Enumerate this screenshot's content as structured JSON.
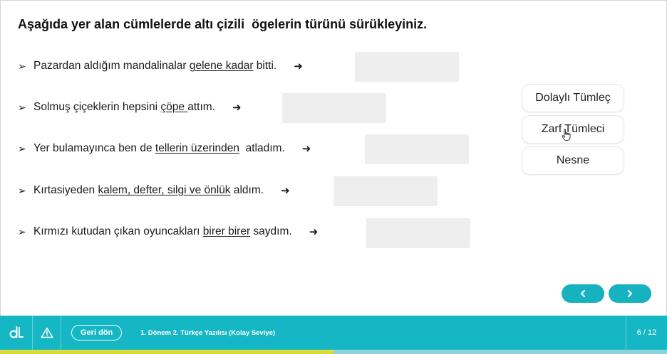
{
  "question": "Aşağıda yer alan cümlelerde altı çizili  ögelerin türünü sürükleyiniz.",
  "sentences": [
    {
      "before": "Pazardan aldığım mandalinalar ",
      "underlined": "gelene kadar",
      "after": " bitti."
    },
    {
      "before": "Solmuş çiçeklerin hepsini ",
      "underlined": "çöpe ",
      "after": "attım."
    },
    {
      "before": "Yer bulamayınca ben de ",
      "underlined": "tellerin üzerinden",
      "after": "  atladım."
    },
    {
      "before": "Kırtasiyeden ",
      "underlined": "kalem, defter, silgi ve önlük",
      "after": " aldım."
    },
    {
      "before": "Kırmızı kutudan çıkan oyuncakları ",
      "underlined": "birer birer",
      "after": " saydım."
    }
  ],
  "bullet": "➢",
  "arrow": "➜",
  "options": [
    "Dolaylı Tümleç",
    "Zarf Tümleci",
    "Nesne"
  ],
  "nav": {
    "prev_icon": "chevron-left-icon",
    "next_icon": "chevron-right-icon"
  },
  "footer": {
    "back_label": "Geri dön",
    "lesson_title": "1. Dönem 2. Türkçe Yazılısı (Kolay Seviye)",
    "page_indicator": "6 / 12",
    "progress": 0.5
  },
  "colors": {
    "accent": "#16b7c4",
    "progress": "#d9db3d",
    "drop_zone": "#eeeeee"
  }
}
